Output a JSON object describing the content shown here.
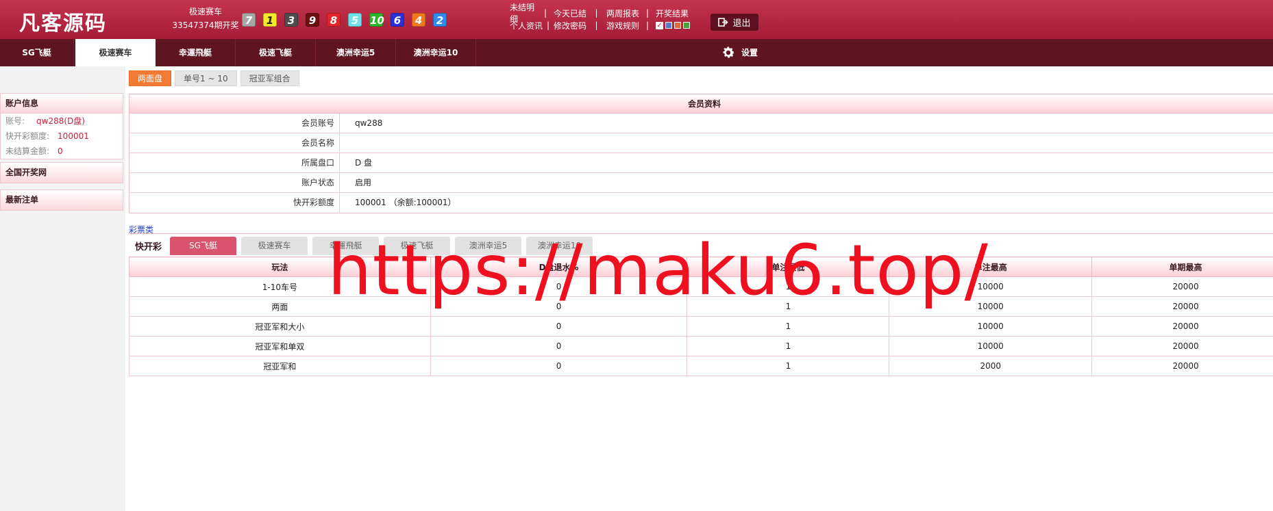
{
  "header": {
    "logo": "凡客源码",
    "game_name": "极速赛车",
    "period": "33547374期开奖",
    "balls": [
      {
        "n": "7",
        "bg": "#a7a7a7",
        "fg": "#ffffff"
      },
      {
        "n": "1",
        "bg": "#f3e92a",
        "fg": "#222222"
      },
      {
        "n": "3",
        "bg": "#4d4d4d",
        "fg": "#ffffff"
      },
      {
        "n": "9",
        "bg": "#6b0f0f",
        "fg": "#ffffff"
      },
      {
        "n": "8",
        "bg": "#e4242b",
        "fg": "#ffffff"
      },
      {
        "n": "5",
        "bg": "#6fe0e8",
        "fg": "#ffffff"
      },
      {
        "n": "10",
        "bg": "#2fb52a",
        "fg": "#ffffff"
      },
      {
        "n": "6",
        "bg": "#2d2fd6",
        "fg": "#ffffff"
      },
      {
        "n": "4",
        "bg": "#f07a1c",
        "fg": "#ffffff"
      },
      {
        "n": "2",
        "bg": "#2f8ae8",
        "fg": "#ffffff"
      }
    ],
    "links_row1": [
      "未结明细",
      "今天已结",
      "两周报表",
      "开奖结果"
    ],
    "links_row2": [
      "个人资讯",
      "修改密码",
      "游戏规则"
    ],
    "separator": "|",
    "check": "✓",
    "swatches": [
      "#5b7cc9",
      "#e06b3a",
      "#4aa43a"
    ],
    "logout": "退出"
  },
  "nav": {
    "tabs": [
      "SG飞艇",
      "极速赛车",
      "幸運飛艇",
      "极速飞艇",
      "澳洲幸运5",
      "澳洲幸运10"
    ],
    "active_index": 1,
    "settings": "设置"
  },
  "sidebar": {
    "account_title": "账户信息",
    "rows": [
      {
        "label": "账号:",
        "value": "qw288(D盘)"
      },
      {
        "label": "快开彩额度:",
        "value": "100001"
      },
      {
        "label": "未结算金额:",
        "value": "0"
      }
    ],
    "national_lottery": "全国开奖网",
    "latest_bets": "最新注单"
  },
  "subtabs": [
    "两面盘",
    "单号1 ~ 10",
    "冠亚军组合"
  ],
  "member": {
    "title": "会员资料",
    "rows": [
      {
        "label": "会员账号",
        "value": "qw288"
      },
      {
        "label": "会员名称",
        "value": ""
      },
      {
        "label": "所属盘口",
        "value": "D 盘"
      },
      {
        "label": "账户状态",
        "value": "启用"
      },
      {
        "label": "快开彩额度",
        "value": "100001 （余额:100001）"
      }
    ]
  },
  "category_label": "彩票类",
  "lottery": {
    "label": "快开彩",
    "tabs": [
      "SG飞艇",
      "极速赛车",
      "幸運飛艇",
      "极速飞艇",
      "澳洲幸运5",
      "澳洲幸运10"
    ]
  },
  "odds_table": {
    "headers": [
      "玩法",
      "D盘退水%",
      "单注最低",
      "单注最高",
      "单期最高"
    ],
    "rows": [
      [
        "1-10车号",
        "0",
        "1",
        "10000",
        "20000"
      ],
      [
        "两面",
        "0",
        "1",
        "10000",
        "20000"
      ],
      [
        "冠亚军和大小",
        "0",
        "1",
        "10000",
        "20000"
      ],
      [
        "冠亚军和单双",
        "0",
        "1",
        "10000",
        "20000"
      ],
      [
        "冠亚军和",
        "0",
        "1",
        "2000",
        "20000"
      ]
    ]
  },
  "watermark": "https://maku6.top/"
}
